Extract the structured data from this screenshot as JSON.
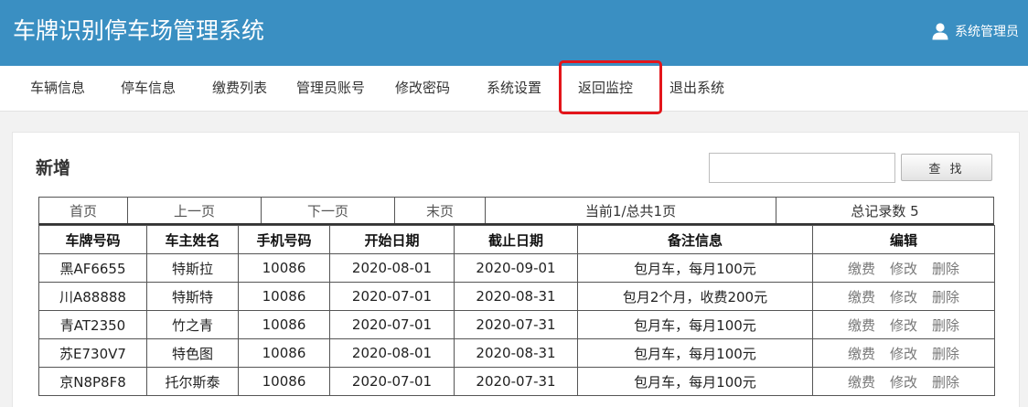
{
  "header": {
    "app_title": "车牌识别停车场管理系统",
    "user_label": "系统管理员",
    "user_icon": "user-icon"
  },
  "nav": {
    "items": [
      {
        "label": "车辆信息"
      },
      {
        "label": "停车信息"
      },
      {
        "label": "缴费列表"
      },
      {
        "label": "管理员账号"
      },
      {
        "label": "修改密码"
      },
      {
        "label": "系统设置"
      },
      {
        "label": "返回监控"
      },
      {
        "label": "退出系统"
      }
    ],
    "highlighted": "返回监控",
    "highlight_color": "#e3151b"
  },
  "panel": {
    "title": "新增",
    "search_value": "",
    "search_button": "查 找"
  },
  "pager": {
    "first": "首页",
    "prev": "上一页",
    "next": "下一页",
    "last": "末页",
    "page_info": "当前1/总共1页",
    "total_info": "总记录数 5"
  },
  "table": {
    "headers": [
      "车牌号码",
      "车主姓名",
      "手机号码",
      "开始日期",
      "截止日期",
      "备注信息",
      "编辑"
    ],
    "rows": [
      {
        "plate": "黑AF6655",
        "owner": "特斯拉",
        "phone": "10086",
        "start": "2020-08-01",
        "end": "2020-09-01",
        "note": "包月车，每月100元"
      },
      {
        "plate": "川A88888",
        "owner": "特斯特",
        "phone": "10086",
        "start": "2020-07-01",
        "end": "2020-08-31",
        "note": "包月2个月，收费200元"
      },
      {
        "plate": "青AT2350",
        "owner": "竹之青",
        "phone": "10086",
        "start": "2020-07-01",
        "end": "2020-07-31",
        "note": "包月车，每月100元"
      },
      {
        "plate": "苏E730V7",
        "owner": "特色图",
        "phone": "10086",
        "start": "2020-08-01",
        "end": "2020-08-31",
        "note": "包月车，每月100元"
      },
      {
        "plate": "京N8P8F8",
        "owner": "托尔斯泰",
        "phone": "10086",
        "start": "2020-07-01",
        "end": "2020-07-31",
        "note": "包月车，每月100元"
      }
    ],
    "actions": {
      "pay": "缴费",
      "edit": "修改",
      "delete": "删除"
    }
  },
  "colors": {
    "header_bg": "#3a8fc2",
    "page_bg": "#f2f2f2"
  }
}
